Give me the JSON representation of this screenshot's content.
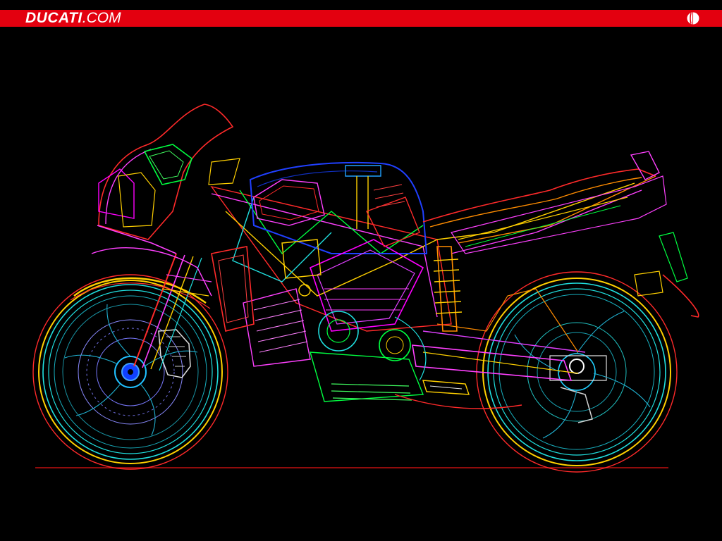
{
  "header": {
    "brand_main": "DUCATI",
    "brand_suffix": ".COM",
    "bar_color": "#e3000f"
  },
  "wallpaper": {
    "subject": "motorcycle-wireframe-icon",
    "background_color": "#000000",
    "palette": [
      "#ff2020",
      "#ff00ff",
      "#00ffff",
      "#ffff00",
      "#00ff40",
      "#ff8c00",
      "#2040ff",
      "#c060ff"
    ]
  }
}
